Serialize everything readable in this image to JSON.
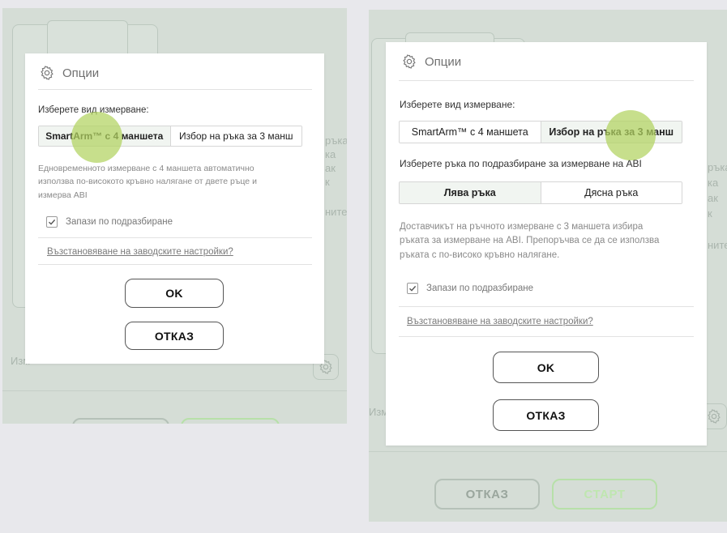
{
  "background_left": {
    "fragments": [
      "ръка",
      "ка",
      "ак",
      "к",
      "ните",
      "Изм"
    ],
    "buttons": {
      "cancel": "",
      "start": ""
    }
  },
  "background_right": {
    "fragments": [
      "ръка",
      "ка",
      "ак",
      "к",
      "ните",
      "Изм"
    ],
    "cancel_label": "ОТКАЗ",
    "start_label": "СТАРТ"
  },
  "dialog_left": {
    "title": "Опции",
    "measurement_label": "Изберете вид измерване:",
    "measurement_options": [
      "SmartArm™ с 4 маншета",
      "Избор на ръка за 3 манш"
    ],
    "selected_measurement": 0,
    "description_lines": [
      "Едновременното измерване с 4 маншета автоматично",
      "използва по-високото кръвно налягане от двете ръце и",
      "измерва ABI"
    ],
    "save_default_label": "Запази по подразбиране",
    "save_default_checked": true,
    "restore_link": "Възстановяване на заводските настройки?",
    "ok_label": "OK",
    "cancel_label": "ОТКАЗ"
  },
  "dialog_right": {
    "title": "Опции",
    "measurement_label": "Изберете вид измерване:",
    "measurement_options": [
      "SmartArm™ с 4 маншета",
      "Избор на ръка за 3 манш"
    ],
    "selected_measurement": 1,
    "arm_label": "Изберете ръка по подразбиране за измерване на ABI",
    "arm_options": [
      "Лява ръка",
      "Дясна ръка"
    ],
    "selected_arm": 0,
    "description_lines": [
      "Доставчикът на ръчното измерване с 3 маншета избира",
      "ръката за измерване на ABI. Препоръчва се да се използва",
      "ръката с по-високо кръвно налягане."
    ],
    "save_default_label": "Запази по подразбиране",
    "save_default_checked": true,
    "restore_link": "Възстановяване на заводските настройки?",
    "ok_label": "OK",
    "cancel_label": "ОТКАЗ"
  },
  "colors": {
    "overlay_bg": "#d5ddd6",
    "touch_indicator": "#b2d25f",
    "selected_segment": "#f1f5f1",
    "start_button": "#bfe6b0"
  },
  "icons": {
    "header": "gear-icon",
    "checkbox": "checkmark-icon"
  }
}
